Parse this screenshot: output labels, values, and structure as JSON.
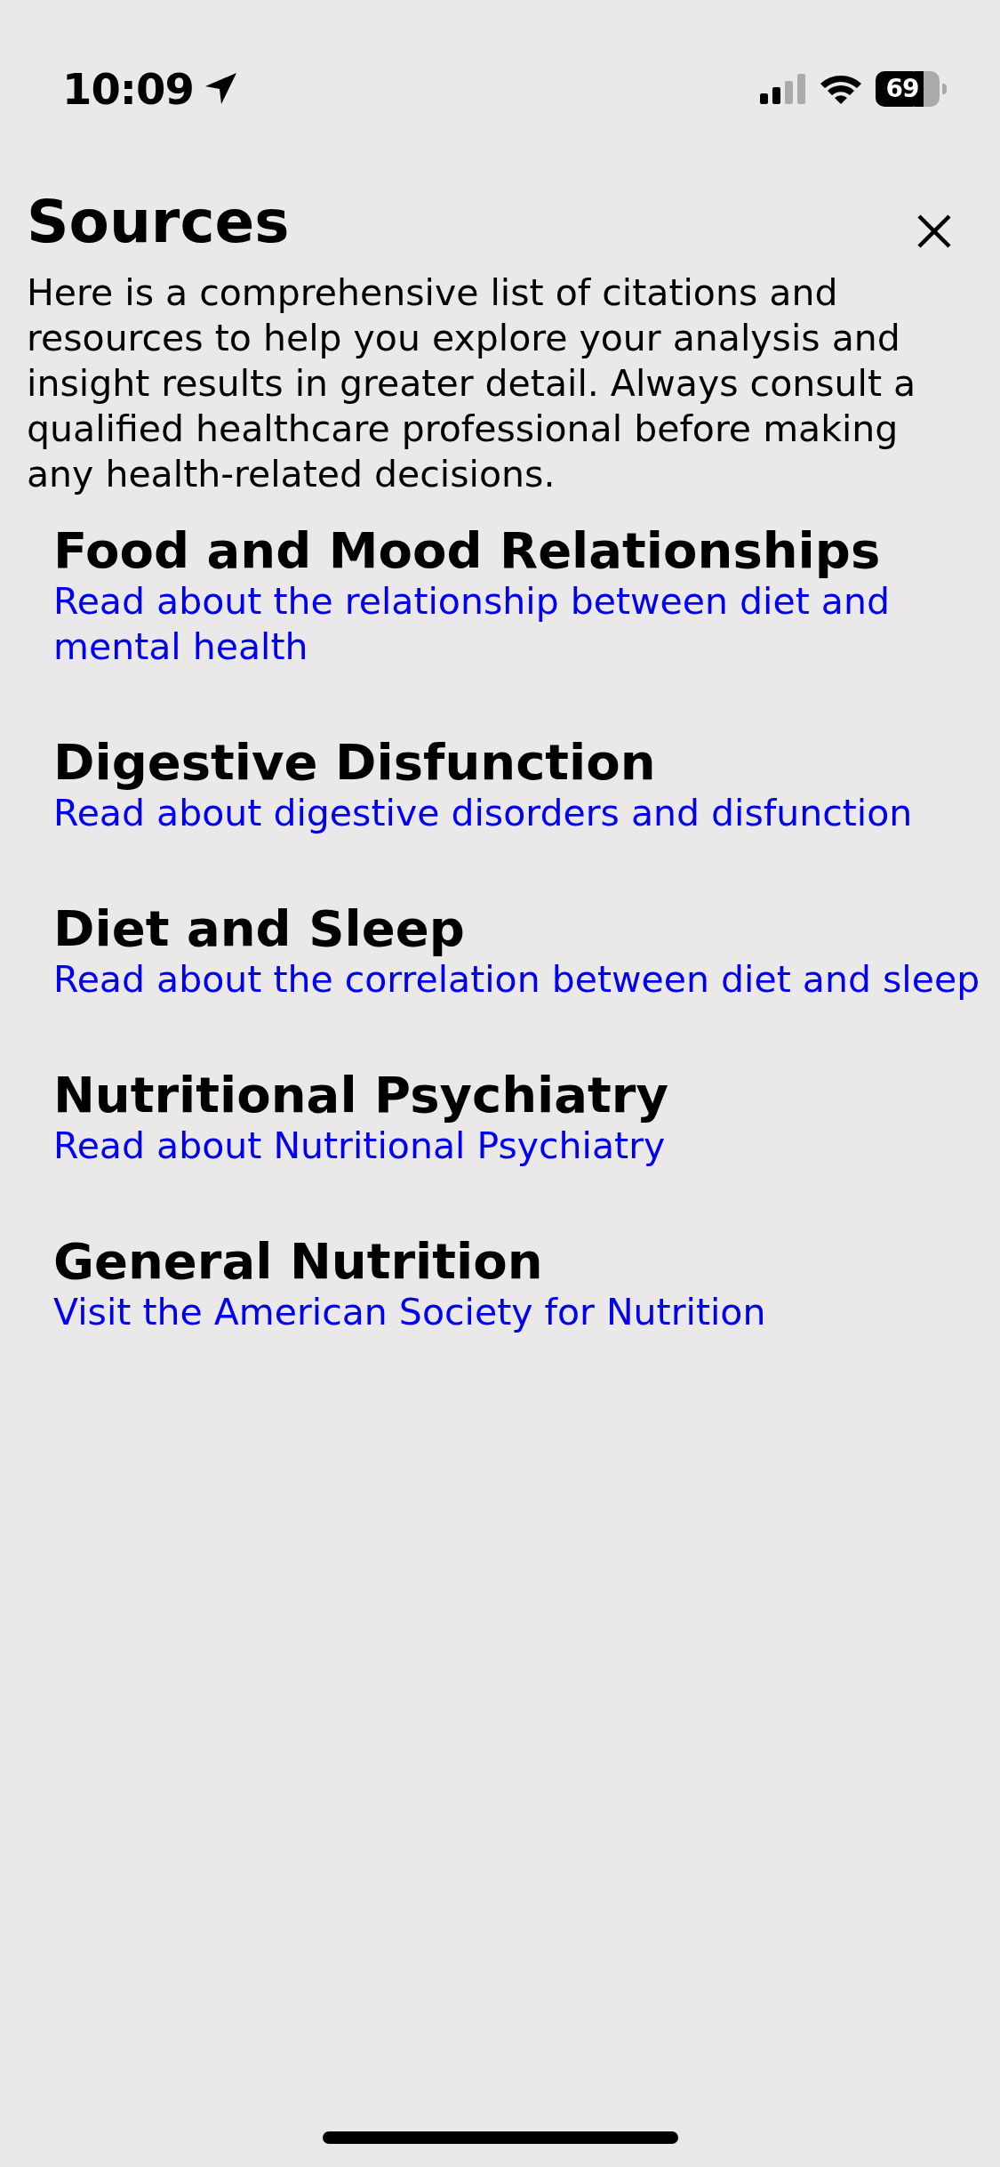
{
  "status_bar": {
    "time": "10:09",
    "battery": "69"
  },
  "title": "Sources",
  "intro": "Here is a comprehensive list of citations and resources to help you explore your analysis and insight results in greater detail. Always consult a qualified healthcare professional before making any health-related decisions.",
  "sources": [
    {
      "title": "Food and Mood Relationships",
      "link": "Read about the relationship between diet and mental health"
    },
    {
      "title": "Digestive Disfunction",
      "link": "Read about digestive disorders and disfunction"
    },
    {
      "title": "Diet and Sleep",
      "link": "Read about the correlation between diet and sleep"
    },
    {
      "title": "Nutritional Psychiatry",
      "link": "Read about Nutritional Psychiatry"
    },
    {
      "title": "General Nutrition",
      "link": "Visit the American Society for Nutrition"
    }
  ]
}
